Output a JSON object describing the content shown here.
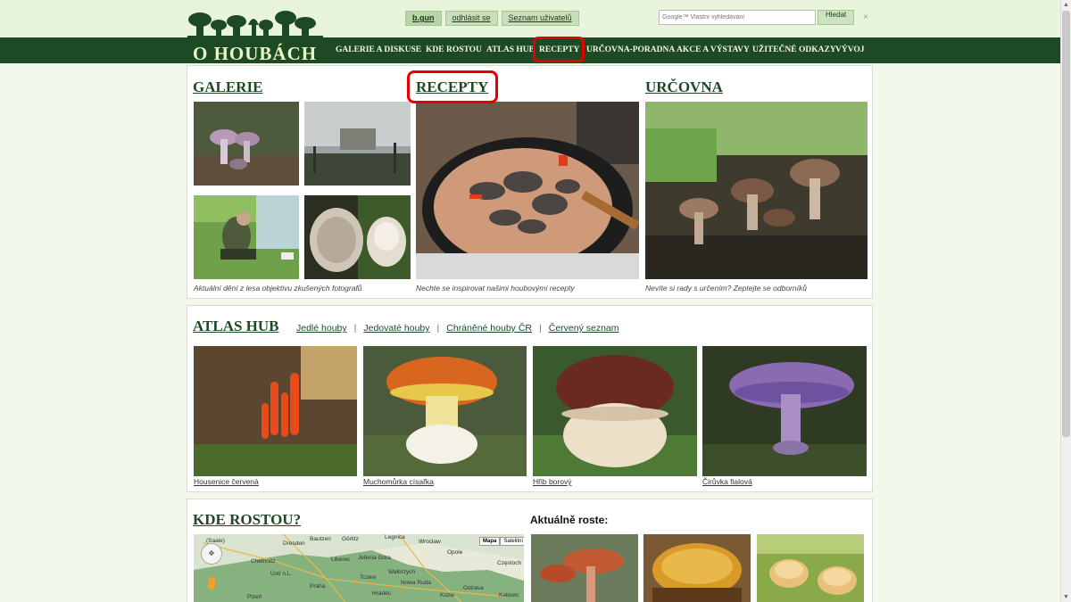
{
  "header": {
    "logo_text": "O HOUBÁCH",
    "user_link": "b.gun",
    "logout_link": "odhlásit se",
    "users_link": "Seznam uživatelů",
    "search_placeholder": "Google™ Vlastní vyhledávání",
    "search_button": "Hledat",
    "close_symbol": "×"
  },
  "nav": [
    {
      "label": "GALERIE A DISKUSE"
    },
    {
      "label": "KDE ROSTOU"
    },
    {
      "label": "ATLAS HUB"
    },
    {
      "label": "RECEPTY",
      "active": true
    },
    {
      "label": "URČOVNA-PORADNA"
    },
    {
      "label": "AKCE A VÝSTAVY"
    },
    {
      "label": "UŽITEČNÉ ODKAZY"
    },
    {
      "label": "VÝVOJ"
    }
  ],
  "galerie": {
    "title": "GALERIE",
    "caption": "Aktuální dění z lesa objektivu zkušených fotografů"
  },
  "recepty": {
    "title": "RECEPTY",
    "caption": "Nechte se inspirovat našimi houbovými recepty"
  },
  "urcovna": {
    "title": "URČOVNA",
    "caption": "Nevíte si rady s určením? Zeptejte se odborníků"
  },
  "atlas": {
    "title": "ATLAS HUB",
    "links": [
      "Jedlé houby",
      "Jedovaté houby",
      "Chráněné houby ČR",
      "Červený seznam"
    ],
    "photos": [
      "Housenice červená",
      "Muchomůrka císařka",
      "Hřib borový",
      "Čirůvka fialová"
    ]
  },
  "kde_rostou": {
    "title": "KDE ROSTOU?",
    "now_growing": "Aktuálně roste:",
    "map_buttons": [
      "Mapa",
      "Satelitní"
    ],
    "map_labels": [
      "(Saale)",
      "Dresden",
      "Bautzen",
      "Görlitz",
      "Legnica",
      "Wrocław",
      "Opole",
      "Częstoch",
      "Chemnitz",
      "Liberec",
      "Jelenia Góra",
      "Wałbrzych",
      "Katowic",
      "Hradec",
      "Ostrava",
      "Kozle",
      "Plzeň",
      "Praha",
      "Tczew",
      "Nowa Ruda",
      "Ústí n.L."
    ]
  },
  "colors": {
    "nav_bg": "#1d4a25",
    "title_green": "#1d4a25",
    "highlight_red": "#e40000",
    "page_bg": "#f2f8ea"
  }
}
